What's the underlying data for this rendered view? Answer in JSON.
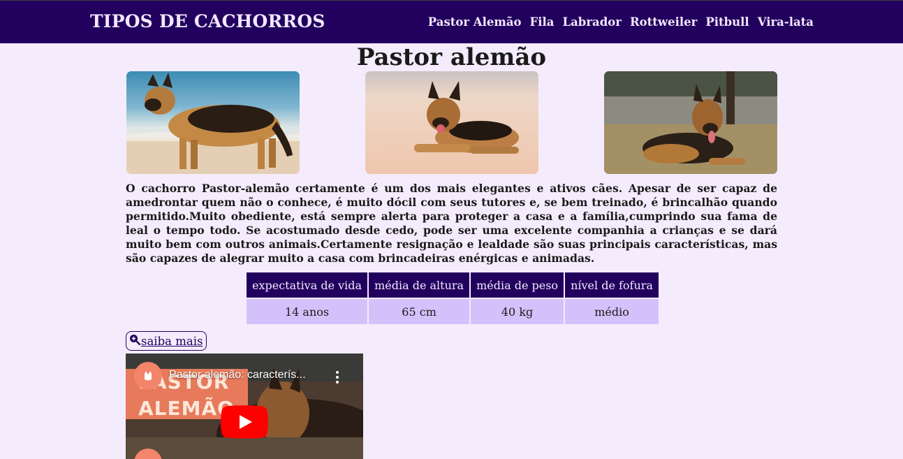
{
  "header": {
    "brand": "TIPOS DE CACHORROS",
    "nav": [
      "Pastor Alemão",
      "Fila",
      "Labrador",
      "Rottweiler",
      "Pitbull",
      "Vira-lata"
    ]
  },
  "main": {
    "title": "Pastor alemão",
    "description": "O cachorro Pastor-alemão certamente é um dos mais elegantes e ativos cães. Apesar de ser capaz de amedrontar quem não o conhece, é muito dócil com seus tutores e, se bem treinado, é brincalhão quando permitido.Muito obediente, está sempre alerta para proteger a casa e a família,cumprindo sua fama de leal o tempo todo. Se acostumado desde cedo, pode ser uma excelente companhia a crianças e se dará muito bem com outros animais.Certamente resignação e lealdade são suas principais características, mas são capazes de alegrar muito a casa com brincadeiras enérgicas e animadas.",
    "table": {
      "headers": [
        "expectativa de vida",
        "média de altura",
        "média de peso",
        "nível de fofura"
      ],
      "values": [
        "14 anos",
        "65 cm",
        "40 kg",
        "médio"
      ]
    },
    "more_button": "saiba mais",
    "video": {
      "title": "Pastor alemão: caracterís...",
      "thumb_text": [
        "PASTOR",
        "ALEMÃO"
      ]
    }
  },
  "colors": {
    "header_bg": "#22005e",
    "page_bg": "#f4ecfd",
    "table_cell_bg": "#d4c1fb",
    "youtube_red": "#ff0000"
  }
}
